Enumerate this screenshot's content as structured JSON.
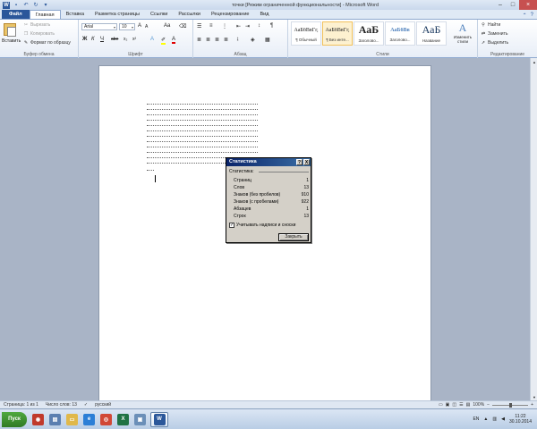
{
  "window": {
    "title": "точки [Режим ограниченной функциональности] - Microsoft Word",
    "app_letter": "W"
  },
  "ribbon_tabs": [
    "Файл",
    "Главная",
    "Вставка",
    "Разметка страницы",
    "Ссылки",
    "Рассылки",
    "Рецензирование",
    "Вид"
  ],
  "clipboard": {
    "paste": "Вставить",
    "cut": "Вырезать",
    "copy": "Копировать",
    "format_painter": "Формат по образцу",
    "label": "Буфер обмена"
  },
  "font": {
    "name": "Arial",
    "size": "10",
    "label": "Шрифт",
    "grow": "A",
    "shrink": "A",
    "case": "Aa",
    "bold": "Ж",
    "italic": "К",
    "underline": "Ч",
    "strike": "abe",
    "sub": "x₂",
    "sup": "x²",
    "color": "A"
  },
  "paragraph": {
    "label": "Абзац",
    "pilcrow": "¶"
  },
  "styles": {
    "label": "Стили",
    "items": [
      {
        "sample": "АаБбВвГг,",
        "name": "¶ Обычный",
        "color": "#222222"
      },
      {
        "sample": "АаБбВвГг,",
        "name": "¶ Без инте...",
        "color": "#222222"
      },
      {
        "sample": "АаБ",
        "name": "Заголово...",
        "color": "#222222"
      },
      {
        "sample": "АаБбВв",
        "name": "Заголово...",
        "color": "#4f81bd"
      },
      {
        "sample": "АаБ",
        "name": "Название",
        "color": "#17365d"
      }
    ],
    "change": "Изменить стили"
  },
  "editing": {
    "label": "Редактирование",
    "find": "Найти",
    "replace": "Заменить",
    "select": "Выделить"
  },
  "dialog": {
    "title": "Статистика",
    "help": "?",
    "close_x": "X",
    "section": "Статистика:",
    "rows": [
      {
        "label": "Страниц",
        "value": "1"
      },
      {
        "label": "Слов",
        "value": "13"
      },
      {
        "label": "Знаков (без пробелов)",
        "value": "910"
      },
      {
        "label": "Знаков (с пробелами)",
        "value": "922"
      },
      {
        "label": "Абзацев",
        "value": "1"
      },
      {
        "label": "Строк",
        "value": "13"
      }
    ],
    "checkbox_label": "Учитывать надписи и сноски",
    "checkbox_mark": "✓",
    "close_button": "Закрыть"
  },
  "statusbar": {
    "page": "Страница: 1 из 1",
    "words": "Число слов: 13",
    "lang": "русский",
    "zoom": "100%"
  },
  "taskbar": {
    "start": "Пуск",
    "lang": "EN",
    "time": "11:22",
    "date": "30.10.2014"
  }
}
